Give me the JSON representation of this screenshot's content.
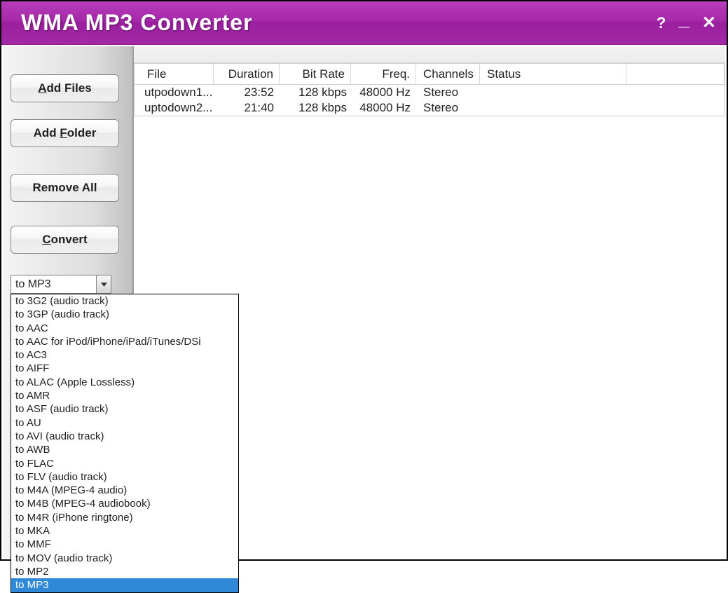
{
  "titlebar": {
    "title": "WMA MP3 Converter"
  },
  "sidebar": {
    "add_files_prefix": "A",
    "add_files_rest": "dd Files",
    "add_folder_prefix": "Add ",
    "add_folder_ul": "F",
    "add_folder_rest": "older",
    "remove_all": "Remove All",
    "convert_ul": "C",
    "convert_rest": "onvert"
  },
  "combo": {
    "selected": "to MP3",
    "options": [
      "to 3G2 (audio track)",
      "to 3GP (audio track)",
      "to AAC",
      "to AAC for iPod/iPhone/iPad/iTunes/DSi",
      "to AC3",
      "to AIFF",
      "to ALAC (Apple Lossless)",
      "to AMR",
      "to ASF (audio track)",
      "to AU",
      "to AVI (audio track)",
      "to AWB",
      "to FLAC",
      "to FLV (audio track)",
      "to M4A (MPEG-4 audio)",
      "to M4B (MPEG-4 audiobook)",
      "to M4R (iPhone ringtone)",
      "to MKA",
      "to MMF",
      "to MOV (audio track)",
      "to MP2",
      "to MP3"
    ],
    "selected_index": 21
  },
  "table": {
    "headers": {
      "file": "File",
      "duration": "Duration",
      "bitrate": "Bit Rate",
      "freq": "Freq.",
      "channels": "Channels",
      "status": "Status"
    },
    "rows": [
      {
        "file": "utpodown1...",
        "duration": "23:52",
        "bitrate": "128 kbps",
        "freq": "48000 Hz",
        "channels": "Stereo",
        "status": ""
      },
      {
        "file": "uptodown2...",
        "duration": "21:40",
        "bitrate": "128 kbps",
        "freq": "48000 Hz",
        "channels": "Stereo",
        "status": ""
      }
    ]
  }
}
